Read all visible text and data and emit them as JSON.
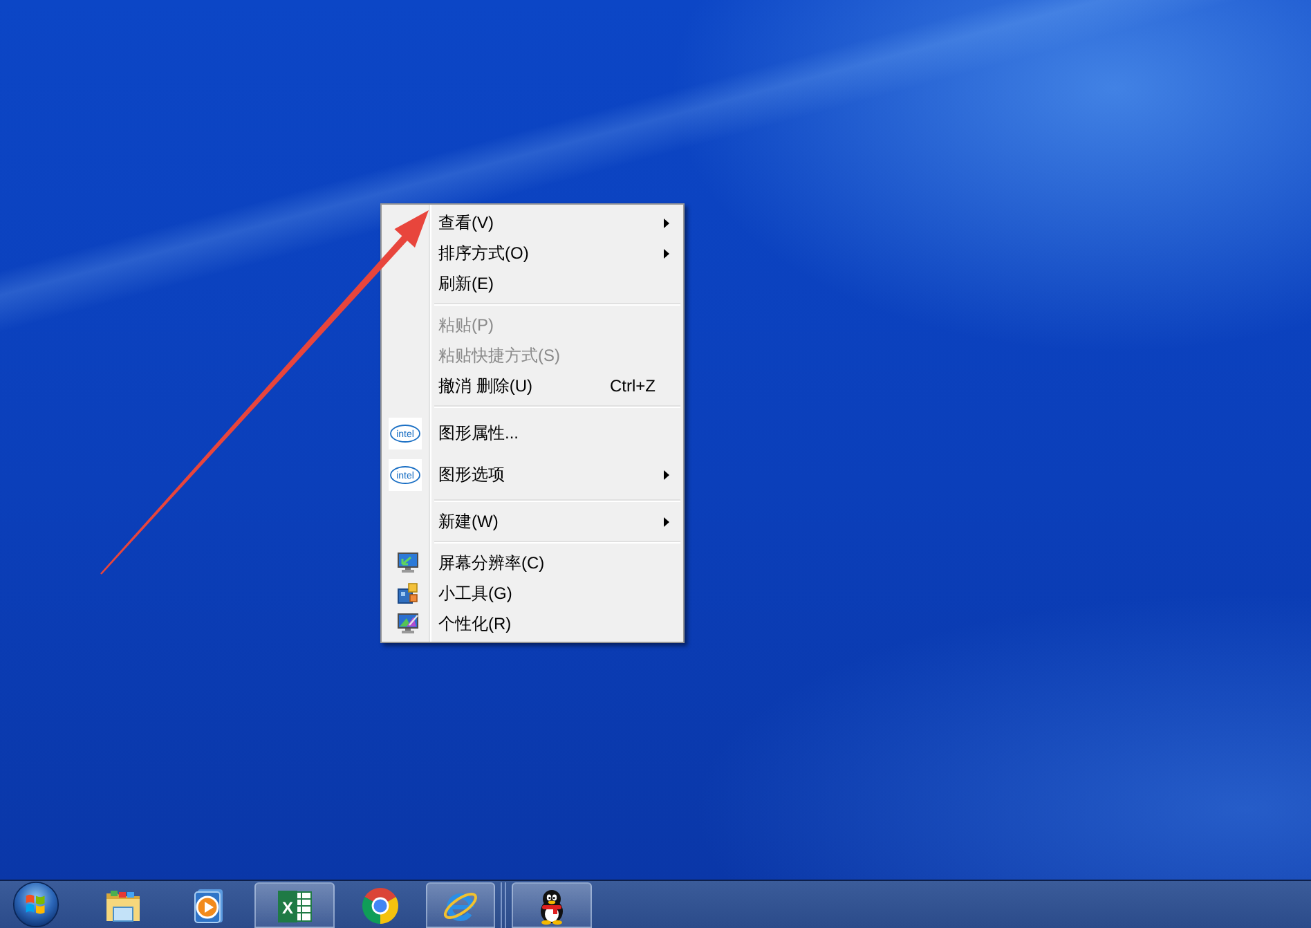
{
  "menu": {
    "items": [
      {
        "kind": "item",
        "label": "查看(V)",
        "submenu": true,
        "disabled": false
      },
      {
        "kind": "item",
        "label": "排序方式(O)",
        "submenu": true,
        "disabled": false
      },
      {
        "kind": "item",
        "label": "刷新(E)",
        "submenu": false,
        "disabled": false
      },
      {
        "kind": "separator"
      },
      {
        "kind": "item",
        "label": "粘贴(P)",
        "submenu": false,
        "disabled": true
      },
      {
        "kind": "item",
        "label": "粘贴快捷方式(S)",
        "submenu": false,
        "disabled": true
      },
      {
        "kind": "item",
        "label": "撤消 删除(U)",
        "shortcut": "Ctrl+Z",
        "submenu": false,
        "disabled": false
      },
      {
        "kind": "separator"
      },
      {
        "kind": "logo_item",
        "logo_text": "intel",
        "label": "图形属性...",
        "submenu": false,
        "disabled": false
      },
      {
        "kind": "logo_item",
        "logo_text": "intel",
        "label": "图形选项",
        "submenu": true,
        "disabled": false
      },
      {
        "kind": "separator"
      },
      {
        "kind": "item",
        "label": "新建(W)",
        "submenu": true,
        "disabled": false
      },
      {
        "kind": "separator"
      },
      {
        "kind": "display_item",
        "label": "屏幕分辨率(C)",
        "submenu": false,
        "disabled": false
      },
      {
        "kind": "gadget_item",
        "label": "小工具(G)",
        "submenu": false,
        "disabled": false
      },
      {
        "kind": "theme_item",
        "label": "个性化(R)",
        "submenu": false,
        "disabled": false
      }
    ]
  },
  "taskbar": {
    "buttons": [
      {
        "kind": "start"
      },
      {
        "kind": "folder",
        "running": false
      },
      {
        "kind": "media",
        "running": false
      },
      {
        "kind": "spreadsheet",
        "glyph": "X",
        "running": true
      },
      {
        "kind": "browser_round",
        "running": false
      },
      {
        "kind": "browser_e",
        "running": true
      },
      {
        "kind": "divider"
      },
      {
        "kind": "penguin",
        "running": true
      }
    ]
  }
}
